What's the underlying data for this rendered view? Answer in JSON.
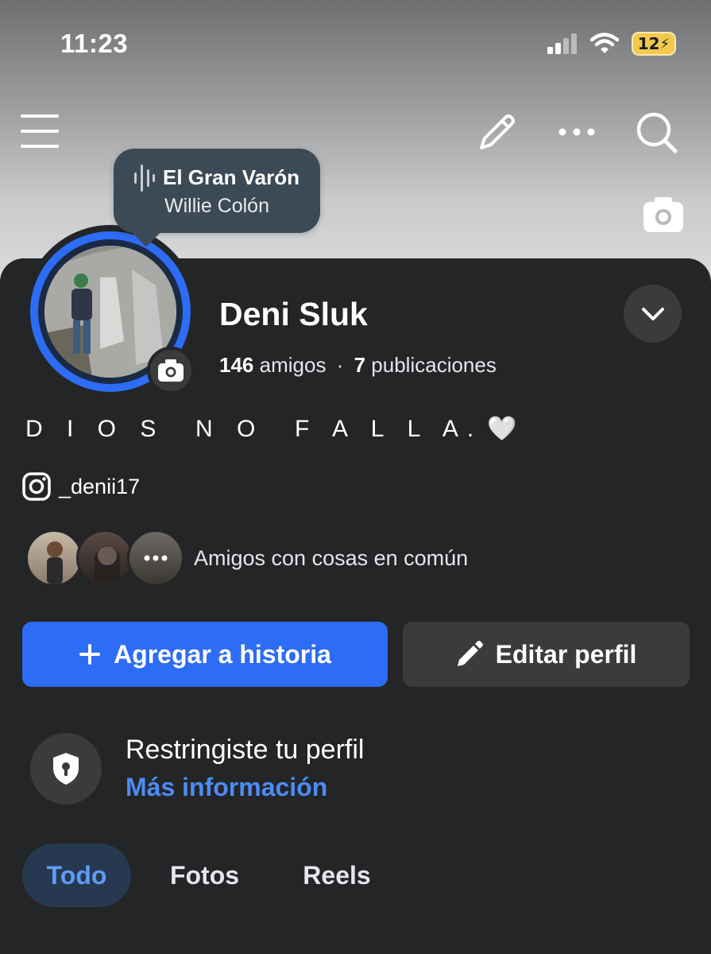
{
  "status_bar": {
    "time": "11:23",
    "battery": "12"
  },
  "now_playing": {
    "title": "El Gran Varón",
    "artist": "Willie Colón"
  },
  "profile": {
    "name": "Deni Sluk",
    "friends_count": "146",
    "friends_label": "amigos",
    "separator": "·",
    "posts_count": "7",
    "posts_label": "publicaciones",
    "bio": "D I O S  N O  F A L L A.",
    "bio_emoji": "🤍",
    "instagram_handle": "_denii17",
    "mutual_text": "Amigos con cosas en común"
  },
  "buttons": {
    "add_story": "Agregar a historia",
    "edit_profile": "Editar perfil"
  },
  "restricted": {
    "title": "Restringiste tu perfil",
    "link": "Más información"
  },
  "tabs": [
    {
      "label": "Todo"
    },
    {
      "label": "Fotos"
    },
    {
      "label": "Reels"
    }
  ],
  "colors": {
    "accent": "#2d6cf4",
    "link": "#4b8cf5",
    "background": "#242526",
    "surface": "#3a3b3c"
  }
}
